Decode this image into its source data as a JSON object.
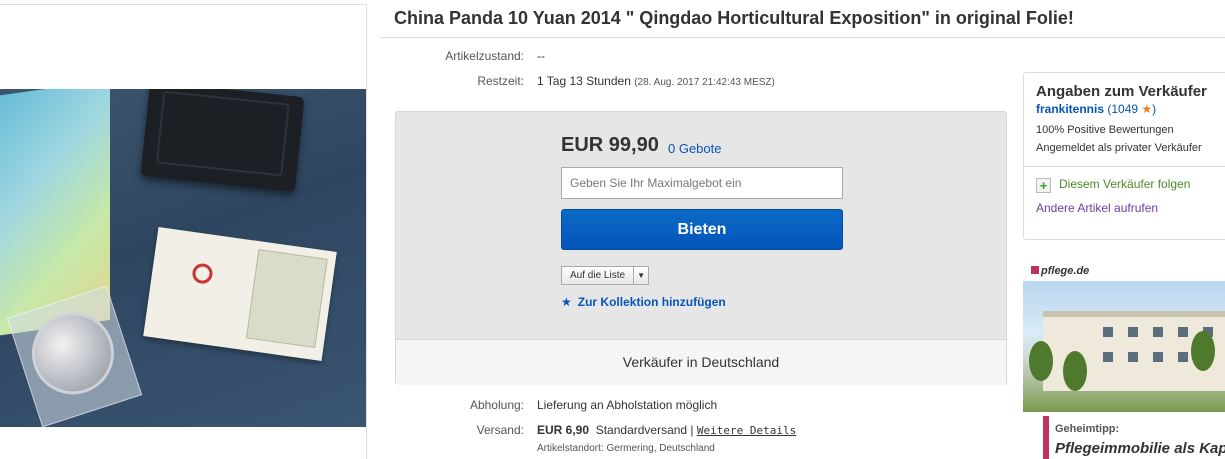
{
  "listing": {
    "title": "China Panda 10 Yuan 2014 \" Qingdao Horticultural Exposition\" in original Folie!"
  },
  "details": {
    "condition_label": "Artikelzustand:",
    "condition_value": "--",
    "time_label": "Restzeit:",
    "time_value": "1 Tag 13 Stunden",
    "time_end": "(28. Aug. 2017   21:42:43 MESZ)"
  },
  "bid": {
    "price": "EUR 99,90",
    "bids_link": "0 Gebote",
    "max_bid_placeholder": "Geben Sie Ihr Maximalgebot ein",
    "bid_button": "Bieten",
    "watchlist_button": "Auf die Liste",
    "collection_link": "Zur Kollektion hinzufügen",
    "seller_location": "Verkäufer in Deutschland"
  },
  "shipping": {
    "pickup_label": "Abholung:",
    "pickup_value": "Lieferung an Abholstation möglich",
    "shipping_label": "Versand:",
    "shipping_price": "EUR 6,90",
    "shipping_method": "Standardversand |",
    "shipping_details_link": "Weitere Details",
    "item_location": "Artikelstandort:  Germering, Deutschland"
  },
  "seller": {
    "heading": "Angaben zum Verkäufer",
    "username": "frankitennis",
    "score": "1049",
    "positive": "100% Positive Bewertungen",
    "type": "Angemeldet als privater Verkäufer",
    "follow": "Diesem Verkäufer folgen",
    "other_items": "Andere Artikel aufrufen"
  },
  "ad": {
    "brand": "pflege.de",
    "tip": "Geheimtipp:",
    "headline": "Pflegeimmobilie als Kapi"
  },
  "colors": {
    "link": "#0654ba",
    "bid_button": "#0654ba",
    "follow_green": "#4a8c2a",
    "visited_purple": "#6b3fa0",
    "star_orange": "#e67e22"
  },
  "icons": {
    "collection": "star-icon",
    "feedback": "star-icon",
    "follow": "plus-icon",
    "watchlist_dropdown": "chevron-down-icon"
  }
}
